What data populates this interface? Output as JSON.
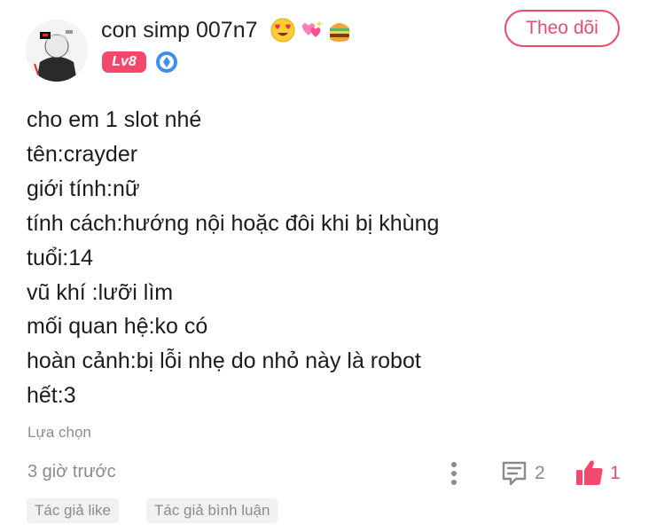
{
  "author": {
    "name": "con simp 007n7",
    "emoji_icons": [
      "heart-eyes-emoji",
      "sparkling-hearts-emoji",
      "hamburger-emoji"
    ],
    "level": "Lv8",
    "medal_icon": "blue-medal-icon"
  },
  "follow_label": "Theo dõi",
  "content_lines": [
    "cho em 1 slot nhé",
    "tên:crayder",
    "giới tính:nữ",
    "tính cách:hướng nội hoặc đôi khi bị khùng",
    "tuổi:14",
    "vũ khí :lưỡi lìm",
    "mối quan hệ:ko có",
    "hoàn cảnh:bị lỗi nhẹ do nhỏ này là robot",
    "hết:3"
  ],
  "options_label": "Lựa chọn",
  "timestamp": "3 giờ trước",
  "comment_count": "2",
  "like_count": "1",
  "chips": [
    "Tác giả like",
    "Tác giả bình luận"
  ],
  "colors": {
    "accent": "#f2486c",
    "muted": "#8a8a8a"
  }
}
